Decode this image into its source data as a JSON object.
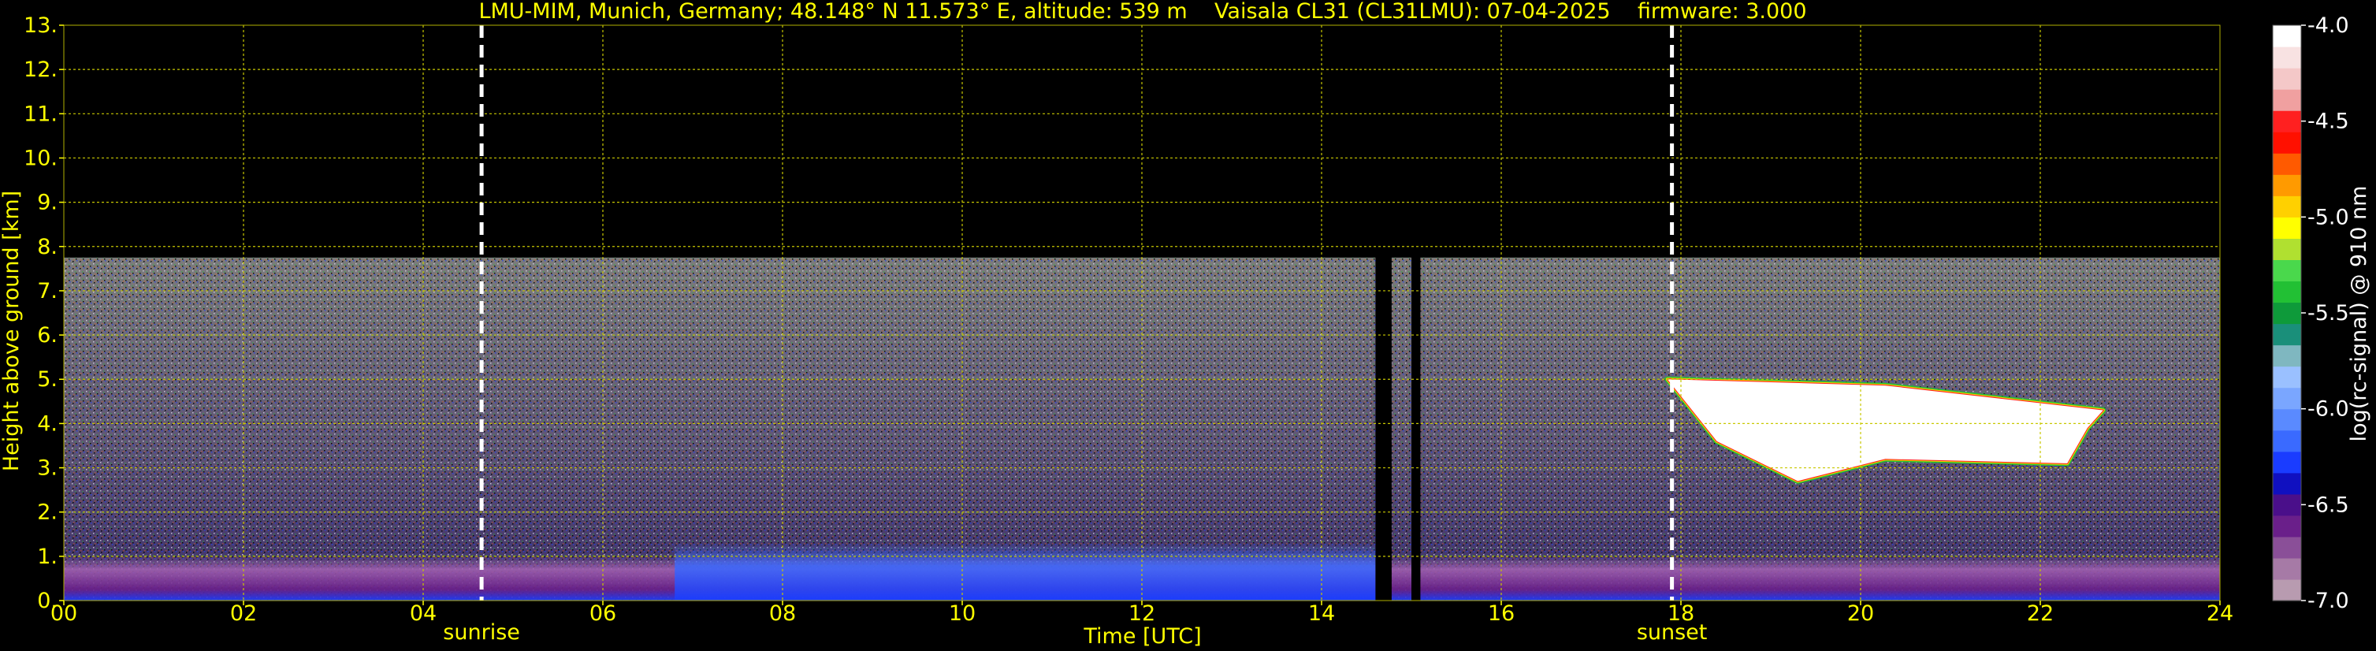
{
  "chart_data": {
    "type": "heatmap",
    "title": "LMU-MIM, Munich, Germany; 48.148° N 11.573° E, altitude: 539 m    Vaisala CL31 (CL31LMU): 07-04-2025    firmware: 3.000",
    "xlabel": "Time [UTC]",
    "ylabel": "Height above ground [km]",
    "xlim": [
      0,
      24
    ],
    "ylim": [
      0,
      13
    ],
    "x_ticks": [
      "00",
      "02",
      "04",
      "06",
      "08",
      "10",
      "12",
      "14",
      "16",
      "18",
      "20",
      "22",
      "24"
    ],
    "y_ticks": [
      "0.",
      "1.",
      "2.",
      "3.",
      "4.",
      "5.",
      "6.",
      "7.",
      "8.",
      "9.",
      "10.",
      "11.",
      "12.",
      "13."
    ],
    "grid": true,
    "data_max_height_km": 7.75,
    "events": [
      {
        "label": "sunrise",
        "time_utc": 4.65
      },
      {
        "label": "sunset",
        "time_utc": 17.9
      }
    ],
    "data_gaps": [
      {
        "start_utc": 14.6,
        "end_utc": 14.78
      },
      {
        "start_utc": 15.0,
        "end_utc": 15.1
      }
    ],
    "cloud_layer": {
      "start_utc": 17.85,
      "end_utc": 22.7,
      "base_km": [
        2.7,
        3.2
      ],
      "top_km": [
        4.3,
        5.0
      ]
    },
    "colorbar": {
      "label": "log(rc-signal) @ 910 nm",
      "range": [
        -7.0,
        -4.0
      ],
      "ticks": [
        "-4.0",
        "-4.5",
        "-5.0",
        "-5.5",
        "-6.0",
        "-6.5",
        "-7.0"
      ],
      "colors": [
        "#b89bb0",
        "#a67aa6",
        "#8a4f98",
        "#6a1f8a",
        "#4a0f8a",
        "#1010c0",
        "#1a3cff",
        "#3a6aff",
        "#5a8aff",
        "#7aa6ff",
        "#9ac0ff",
        "#7fb7c0",
        "#1a8f7a",
        "#0e9a3a",
        "#22c034",
        "#4ad84c",
        "#b0e030",
        "#ffff00",
        "#ffd000",
        "#ff9a00",
        "#ff5a00",
        "#ff1000",
        "#ff2020",
        "#f0a0a0",
        "#f4c8c8",
        "#f8e2e2",
        "#ffffff"
      ]
    }
  }
}
